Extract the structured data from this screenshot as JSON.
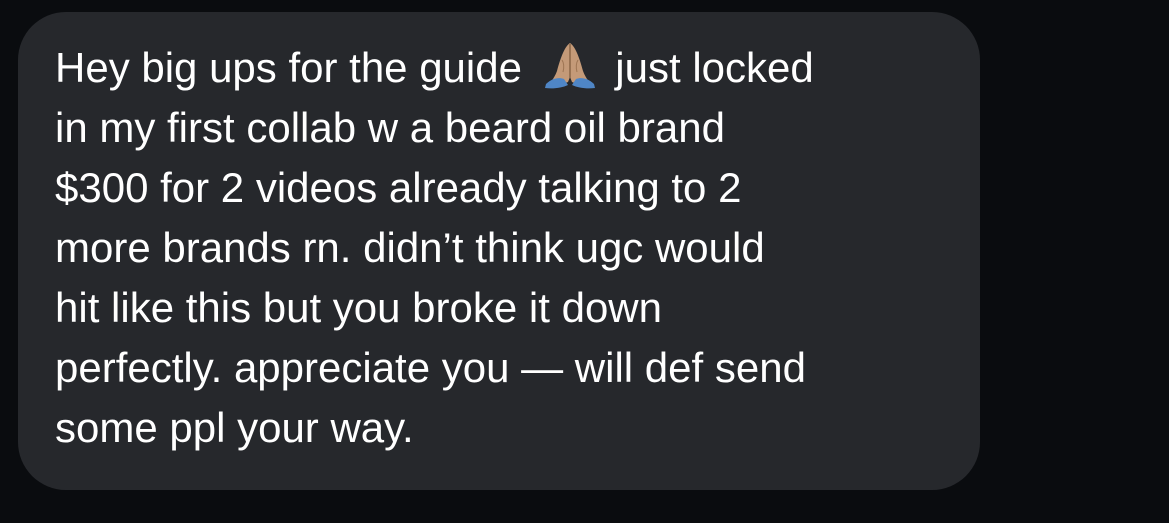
{
  "message": {
    "lines": [
      {
        "before_emoji": "Hey big ups for the guide ",
        "after_emoji": " just locked"
      },
      "in my first collab w a beard oil brand",
      "$300 for 2 videos already talking to 2",
      "more brands rn. didn’t think ugc would",
      "hit like this but you broke it down",
      "perfectly. appreciate you — will def send",
      "some ppl your way."
    ],
    "emoji_icon": "folded-hands-icon"
  },
  "colors": {
    "background": "#0a0c0f",
    "bubble": "#26282c",
    "text": "#ffffff"
  }
}
